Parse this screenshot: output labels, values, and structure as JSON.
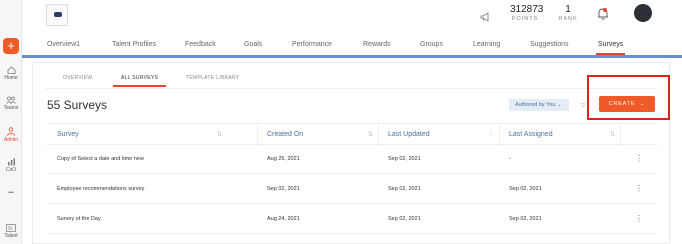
{
  "rail": {
    "add_icon": "plus-icon",
    "items": [
      {
        "label": "Home",
        "icon": "home-icon"
      },
      {
        "label": "Teams",
        "icon": "teams-icon"
      },
      {
        "label": "Admin",
        "icon": "admin-icon",
        "active": true
      },
      {
        "label": "CxO",
        "icon": "cxo-icon"
      },
      {
        "label": "•••",
        "icon": "more-icon"
      },
      {
        "label": "Talent",
        "icon": "talent-icon"
      }
    ]
  },
  "header": {
    "points_value": "312873",
    "points_label": "POINTS",
    "rank_value": "1",
    "rank_label": "RANK"
  },
  "nav": {
    "tabs": [
      "Overview1",
      "Talent Profiles",
      "Feedback",
      "Goals",
      "Performance",
      "Rewards",
      "Groups",
      "Learning",
      "Suggestions",
      "Surveys"
    ],
    "active": "Surveys"
  },
  "subtabs": {
    "items": [
      "OVERVIEW",
      "ALL SURVEYS",
      "TEMPLATE LIBRARY"
    ],
    "active": "ALL SURVEYS"
  },
  "page": {
    "title": "55 Surveys",
    "filter_label": "Authored by You",
    "create_label": "CREATE"
  },
  "table": {
    "columns": [
      "Survey",
      "Created On",
      "Last Updated",
      "Last Assigned"
    ],
    "rows": [
      [
        "Copy of Select a date and time new",
        "Aug 25, 2021",
        "Sep 02, 2021",
        "-"
      ],
      [
        "Employee recommendations survey",
        "Sep 02, 2021",
        "Sep 02, 2021",
        "Sep 02, 2021"
      ],
      [
        "Survey of the Day",
        "Aug 24, 2021",
        "Sep 02, 2021",
        "Sep 02, 2021"
      ]
    ]
  },
  "colors": {
    "accent": "#f05a28",
    "nav_underline": "#6a8fc7",
    "highlight_box": "#e0201b",
    "link_blue": "#4a6fa5"
  }
}
